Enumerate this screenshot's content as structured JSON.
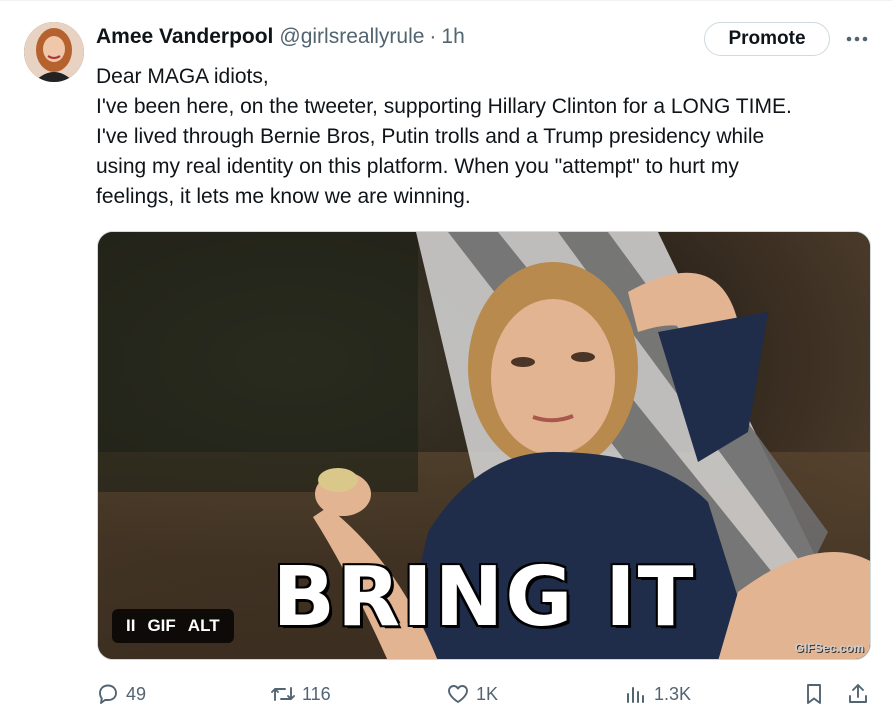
{
  "tweet": {
    "author_name": "Amee Vanderpool",
    "handle": "@girlsreallyrule",
    "separator": "·",
    "time": "1h",
    "promote_label": "Promote",
    "body_lines": [
      "Dear MAGA idiots,",
      "I've been here, on the tweeter, supporting Hillary Clinton for a LONG TIME.",
      "I've lived through Bernie Bros, Putin trolls and a Trump presidency while",
      "using my real identity on this platform. When you \"attempt\" to hurt my",
      "feelings, it lets me know we are winning."
    ]
  },
  "media": {
    "caption": "BRING IT",
    "watermark": "GIFSec.com",
    "controls": {
      "pause_label": "II",
      "gif_label": "GIF",
      "alt_label": "ALT"
    }
  },
  "actions": {
    "replies": "49",
    "reposts": "116",
    "likes": "1K",
    "views": "1.3K"
  },
  "icons": [
    "more-icon",
    "pause-icon",
    "reply-icon",
    "repost-icon",
    "like-icon",
    "views-icon",
    "bookmark-icon",
    "share-icon"
  ],
  "colors": {
    "text": "#0f1419",
    "secondary": "#536471",
    "border": "#cfd9de"
  }
}
